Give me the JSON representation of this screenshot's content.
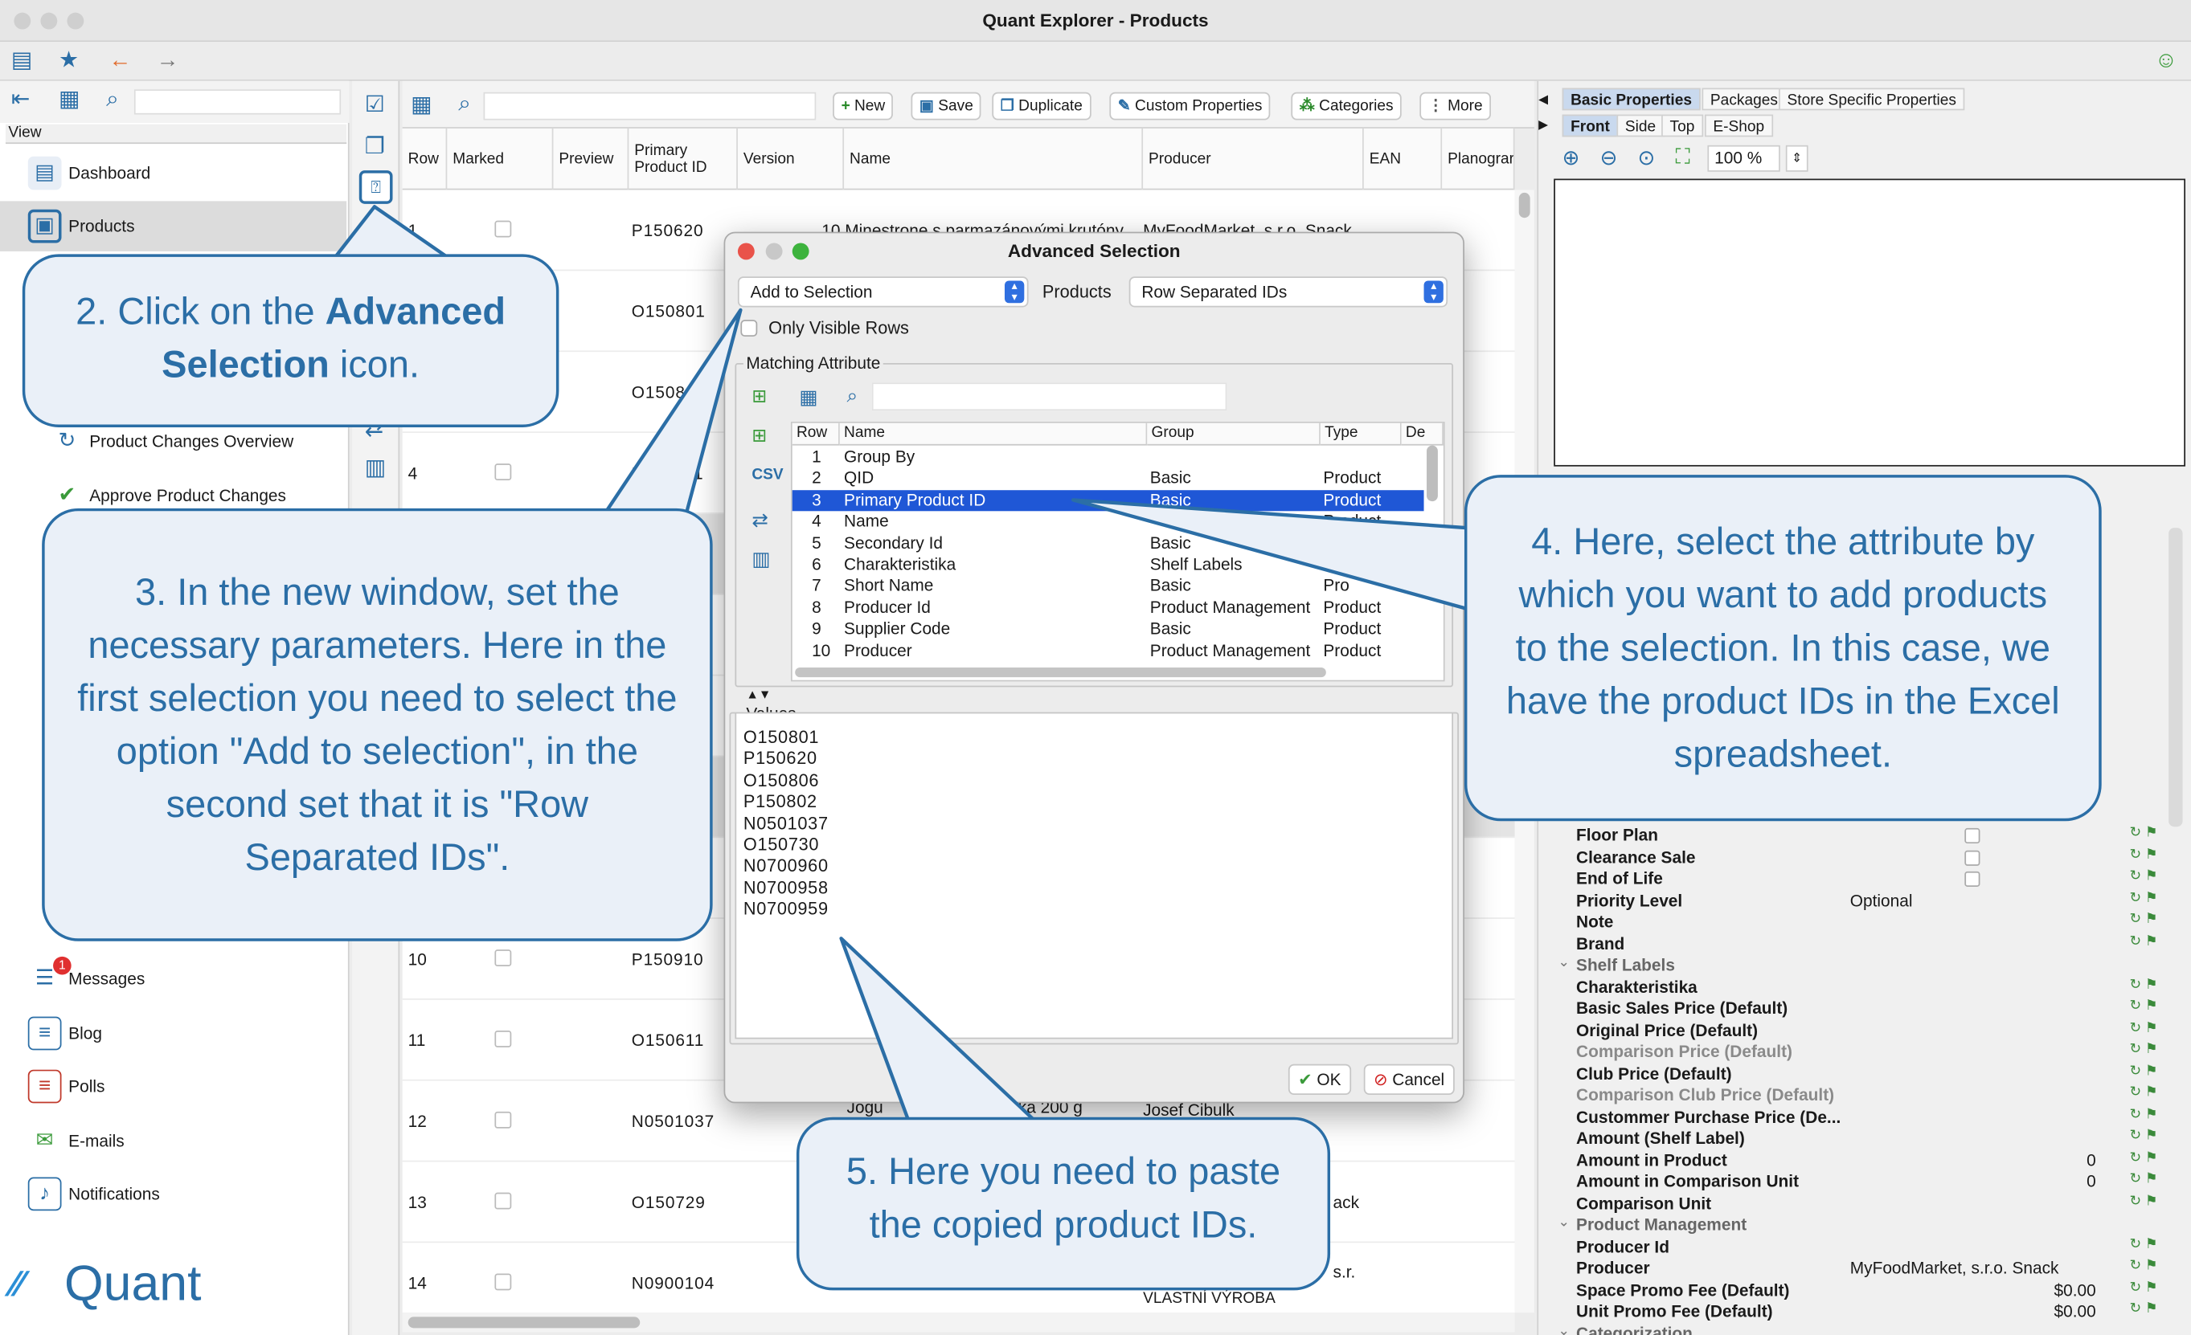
{
  "window": {
    "title": "Quant Explorer - Products"
  },
  "sidebar": {
    "view_label": "View",
    "items": [
      {
        "label": "Dashboard"
      },
      {
        "label": "Products"
      },
      {
        "label": "Product Changes Overview"
      },
      {
        "label": "Approve Product Changes"
      },
      {
        "label": "Messages",
        "badge": "1"
      },
      {
        "label": "Blog"
      },
      {
        "label": "Polls"
      },
      {
        "label": "E-mails"
      },
      {
        "label": "Notifications"
      }
    ],
    "logo_text": "Quant"
  },
  "toolbar": {
    "new_label": "New",
    "save_label": "Save",
    "duplicate_label": "Duplicate",
    "custom_properties_label": "Custom Properties",
    "categories_label": "Categories",
    "more_label": "More"
  },
  "grid": {
    "columns": [
      "Row",
      "Marked",
      "Preview",
      "Primary Product ID",
      "Version",
      "Name",
      "Producer",
      "EAN",
      "Planograr"
    ],
    "rows": [
      {
        "row": "1",
        "product_id": "P150620",
        "name_fragment": "10 Minestrone s parmazánovými krutóny",
        "producer_fragment": "MyFoodMarket, s.r.o. Snack"
      },
      {
        "row": "",
        "product_id": "O150801"
      },
      {
        "row": "",
        "product_id": "O150806"
      },
      {
        "row": "4",
        "product_id": "P150801"
      },
      {
        "row": "10",
        "product_id": "P150910"
      },
      {
        "row": "11",
        "product_id": "O150611"
      },
      {
        "row": "12",
        "product_id": "N0501037",
        "name_fragment": "Jogu",
        "name_fragment_2": "nka 200 g",
        "producer_fragment": "Josef Cibulk"
      },
      {
        "row": "13",
        "product_id": "O150729",
        "producer_fragment": "ack"
      },
      {
        "row": "14",
        "product_id": "N0900104",
        "producer_fragment": "s.r.",
        "name_fragment": "VLASTNÍ VÝROBA"
      }
    ]
  },
  "right_panel": {
    "tabs": [
      "Basic Properties",
      "Packages",
      "Store Specific Properties"
    ],
    "view_tabs": [
      "Front",
      "Side",
      "Top",
      "E-Shop"
    ],
    "zoom": "100 %",
    "properties": [
      {
        "label": "Floor Plan",
        "type": "checkbox"
      },
      {
        "label": "Clearance Sale",
        "type": "checkbox"
      },
      {
        "label": "End of Life",
        "type": "checkbox"
      },
      {
        "label": "Priority Level",
        "value": "Optional"
      },
      {
        "label": "Note"
      },
      {
        "label": "Brand"
      },
      {
        "label": "Shelf Labels",
        "group": true
      },
      {
        "label": "Charakteristika"
      },
      {
        "label": "Basic Sales Price (Default)"
      },
      {
        "label": "Original Price (Default)"
      },
      {
        "label": "Comparison Price (Default)",
        "disabled": true
      },
      {
        "label": "Club Price (Default)"
      },
      {
        "label": "Comparison Club Price (Default)",
        "disabled": true
      },
      {
        "label": "Custommer Purchase Price (De..."
      },
      {
        "label": "Amount (Shelf Label)"
      },
      {
        "label": "Amount in Product",
        "right": "0"
      },
      {
        "label": "Amount in Comparison Unit",
        "right": "0"
      },
      {
        "label": "Comparison Unit"
      },
      {
        "label": "Product Management",
        "group": true
      },
      {
        "label": "Producer Id"
      },
      {
        "label": "Producer",
        "value": "MyFoodMarket, s.r.o. Snack"
      },
      {
        "label": "Space Promo Fee (Default)",
        "right": "$0.00"
      },
      {
        "label": "Unit Promo Fee (Default)",
        "right": "$0.00"
      },
      {
        "label": "Categorization",
        "group": true
      }
    ]
  },
  "dialog": {
    "title": "Advanced Selection",
    "mode_select": "Add to Selection",
    "products_label": "Products",
    "format_select": "Row Separated IDs",
    "only_visible_label": "Only Visible Rows",
    "matching_title": "Matching Attribute",
    "matching_columns": [
      "Row",
      "Name",
      "Group",
      "Type",
      "De"
    ],
    "matching_rows": [
      {
        "row": "1",
        "name": "Group By",
        "group": "",
        "type": ""
      },
      {
        "row": "2",
        "name": "QID",
        "group": "Basic",
        "type": "Product"
      },
      {
        "row": "3",
        "name": "Primary Product ID",
        "group": "Basic",
        "type": "Product",
        "selected": true
      },
      {
        "row": "4",
        "name": "Name",
        "group": "",
        "type": "Product"
      },
      {
        "row": "5",
        "name": "Secondary Id",
        "group": "Basic",
        "type": ""
      },
      {
        "row": "6",
        "name": "Charakteristika",
        "group": "Shelf Labels",
        "type": ""
      },
      {
        "row": "7",
        "name": "Short Name",
        "group": "Basic",
        "type": "Pro"
      },
      {
        "row": "8",
        "name": "Producer Id",
        "group": "Product Management",
        "type": "Product"
      },
      {
        "row": "9",
        "name": "Supplier Code",
        "group": "Basic",
        "type": "Product"
      },
      {
        "row": "10",
        "name": "Producer",
        "group": "Product Management",
        "type": "Product"
      }
    ],
    "values_label": "Values",
    "values": [
      "O150801",
      "P150620",
      "O150806",
      "P150802",
      "N0501037",
      "O150730",
      "N0700960",
      "N0700958",
      "N0700959"
    ],
    "ok_label": "OK",
    "cancel_label": "Cancel"
  },
  "callouts": {
    "c2_pre": "2. Click on the ",
    "c2_bold1": "Advanced",
    "c2_bold2": "Selection",
    "c2_post": " icon.",
    "c3": "3. In the new window, set the necessary parameters. Here in the first selection you need to select the option \"Add to selection\", in the second set that it is \"Row Separated IDs\".",
    "c4": "4. Here, select the attribute by which you want to add products to the selection. In this case, we have the product IDs in the Excel spreadsheet.",
    "c5": "5. Here you need to paste the copied product IDs."
  },
  "colors": {
    "accent": "#2b6ea6",
    "callout_bg": "#eaf0f8",
    "selection": "#1f57d6",
    "combo_arrow": "#2f6fe0"
  }
}
